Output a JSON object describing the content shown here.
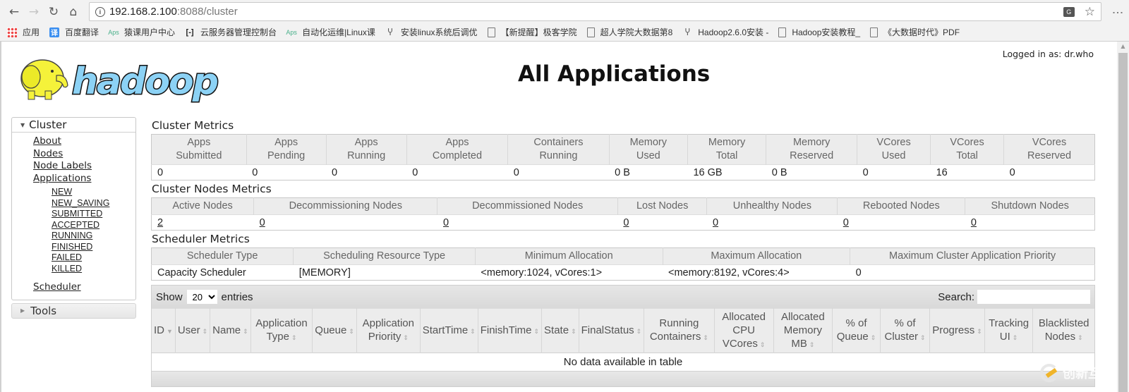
{
  "browser": {
    "url_host": "192.168.2.100",
    "url_rest": ":8088/cluster",
    "bookmarks": [
      {
        "icon": "apps-grid-icon",
        "label": "应用"
      },
      {
        "icon": "baidu-translate-icon",
        "label": "百度翻译"
      },
      {
        "icon": "aps-icon",
        "label": "猿课用户中心"
      },
      {
        "icon": "cloud-console-icon",
        "label": "云服务器管理控制台"
      },
      {
        "icon": "aps-icon",
        "label": "自动化运维|Linux课"
      },
      {
        "icon": "link-icon",
        "label": "安装linux系统后调优"
      },
      {
        "icon": "document-icon",
        "label": "【新提醒】极客学院"
      },
      {
        "icon": "document-icon",
        "label": "超人学院大数据第8"
      },
      {
        "icon": "link-icon",
        "label": "Hadoop2.6.0安装 -"
      },
      {
        "icon": "document-icon",
        "label": "Hadoop安装教程_"
      },
      {
        "icon": "document-icon",
        "label": "《大数据时代》PDF"
      }
    ]
  },
  "header": {
    "logged_in": "Logged in as: dr.who",
    "title": "All Applications",
    "logo_text": "hadoop"
  },
  "sidebar": {
    "cluster_label": "Cluster",
    "links": [
      "About",
      "Nodes",
      "Node Labels",
      "Applications"
    ],
    "app_states": [
      "NEW",
      "NEW_SAVING",
      "SUBMITTED",
      "ACCEPTED",
      "RUNNING",
      "FINISHED",
      "FAILED",
      "KILLED"
    ],
    "scheduler": "Scheduler",
    "tools_label": "Tools"
  },
  "cluster_metrics": {
    "title": "Cluster Metrics",
    "headers": [
      [
        "Apps",
        "Submitted"
      ],
      [
        "Apps",
        "Pending"
      ],
      [
        "Apps",
        "Running"
      ],
      [
        "Apps",
        "Completed"
      ],
      [
        "Containers",
        "Running"
      ],
      [
        "Memory",
        "Used"
      ],
      [
        "Memory",
        "Total"
      ],
      [
        "Memory",
        "Reserved"
      ],
      [
        "VCores",
        "Used"
      ],
      [
        "VCores",
        "Total"
      ],
      [
        "VCores",
        "Reserved"
      ]
    ],
    "values": [
      "0",
      "0",
      "0",
      "0",
      "0",
      "0 B",
      "16 GB",
      "0 B",
      "0",
      "16",
      "0"
    ]
  },
  "nodes_metrics": {
    "title": "Cluster Nodes Metrics",
    "headers": [
      "Active Nodes",
      "Decommissioning Nodes",
      "Decommissioned Nodes",
      "Lost Nodes",
      "Unhealthy Nodes",
      "Rebooted Nodes",
      "Shutdown Nodes"
    ],
    "values": [
      "2",
      "0",
      "0",
      "0",
      "0",
      "0",
      "0"
    ]
  },
  "scheduler_metrics": {
    "title": "Scheduler Metrics",
    "headers": [
      "Scheduler Type",
      "Scheduling Resource Type",
      "Minimum Allocation",
      "Maximum Allocation",
      "Maximum Cluster Application Priority"
    ],
    "values": [
      "Capacity Scheduler",
      "[MEMORY]",
      "<memory:1024, vCores:1>",
      "<memory:8192, vCores:4>",
      "0"
    ]
  },
  "apps_table": {
    "show_label": "Show",
    "entries_value": "20",
    "entries_label": "entries",
    "search_label": "Search:",
    "search_value": "",
    "columns": [
      "ID",
      "User",
      "Name",
      "Application Type",
      "Queue",
      "Application Priority",
      "StartTime",
      "FinishTime",
      "State",
      "FinalStatus",
      "Running Containers",
      "Allocated CPU VCores",
      "Allocated Memory MB",
      "% of Queue",
      "% of Cluster",
      "Progress",
      "Tracking UI",
      "Blacklisted Nodes"
    ],
    "empty_message": "No data available in table"
  },
  "watermark": "创新互联"
}
